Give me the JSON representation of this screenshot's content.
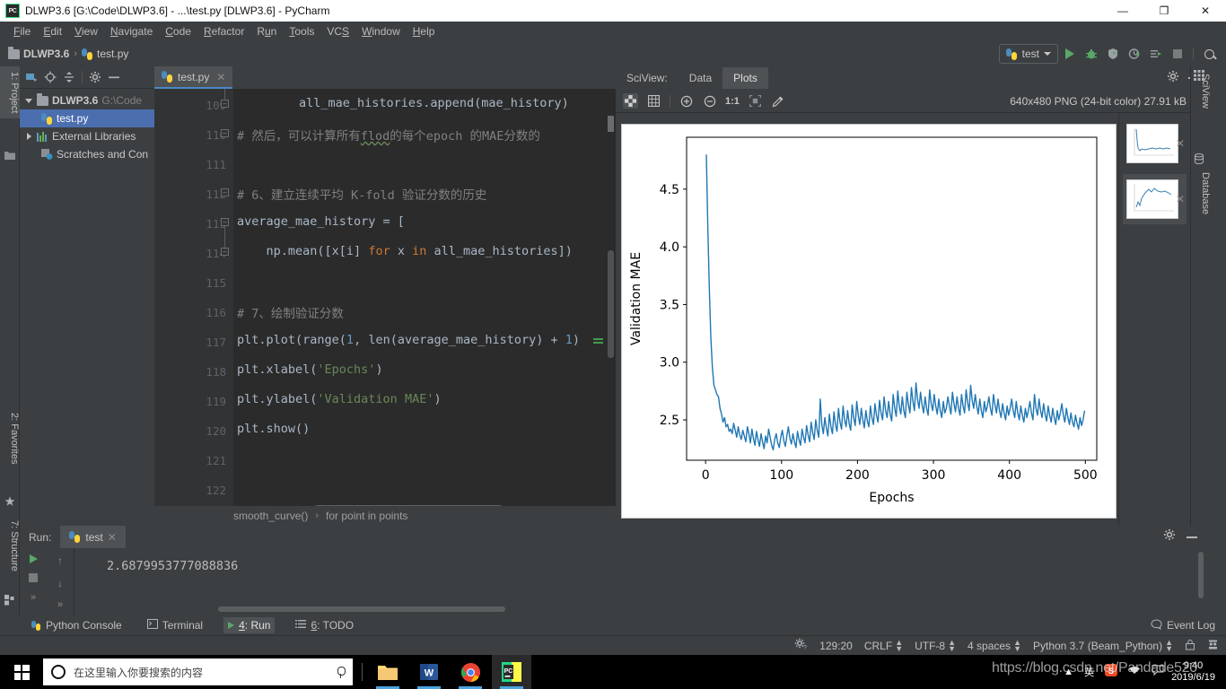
{
  "window": {
    "title": "DLWP3.6 [G:\\Code\\DLWP3.6] - ...\\test.py [DLWP3.6] - PyCharm",
    "app_icon": "pycharm-icon",
    "minimize": "—",
    "maximize": "❐",
    "close": "✕"
  },
  "menubar": {
    "items": [
      "File",
      "Edit",
      "View",
      "Navigate",
      "Code",
      "Refactor",
      "Run",
      "Tools",
      "VCS",
      "Window",
      "Help"
    ]
  },
  "navbar": {
    "crumbs": [
      {
        "label": "DLWP3.6",
        "icon": "folder-icon"
      },
      {
        "label": "test.py",
        "icon": "python-file-icon"
      }
    ],
    "separator": "›",
    "run_config": "test",
    "actions": [
      "run-button",
      "debug-button",
      "coverage-button",
      "profile-button",
      "run-with-console-button",
      "stop-button",
      "search-everywhere-button"
    ]
  },
  "left_strip": {
    "top_tab": "1: Project",
    "bottom_tabs": [
      "2: Favorites",
      "7: Structure"
    ]
  },
  "project": {
    "toolbar": [
      "select-opened-file-icon",
      "locate-icon",
      "collapse-all-icon",
      "settings-icon",
      "hide-icon"
    ],
    "tree": [
      {
        "label": "DLWP3.6",
        "suffix": "G:\\Code",
        "twist": "down",
        "icon": "folder-icon",
        "indent": 0,
        "selected": false,
        "bold": true
      },
      {
        "label": "test.py",
        "suffix": "",
        "twist": "none",
        "icon": "python-file-icon",
        "indent": 1,
        "selected": true,
        "bold": false
      },
      {
        "label": "External Libraries",
        "suffix": "",
        "twist": "right",
        "icon": "library-icon",
        "indent": 0,
        "selected": false,
        "bold": false
      },
      {
        "label": "Scratches and Con",
        "suffix": "",
        "twist": "none",
        "icon": "scratch-icon",
        "indent": 1,
        "selected": false,
        "bold": false
      }
    ]
  },
  "editor": {
    "tab": {
      "label": "test.py",
      "icon": "python-file-icon",
      "close": "✕"
    },
    "lines": [
      {
        "n": "109",
        "fold": "minus-small",
        "text": "        all_mae_histories.append(mae_history)",
        "kind": "code"
      },
      {
        "n": "110",
        "fold": "minus-cap",
        "text": "# 然后，可以计算所有flod的每个epoch 的MAE分数的",
        "kind": "comment"
      },
      {
        "n": "111",
        "fold": "",
        "text": "",
        "kind": "code"
      },
      {
        "n": "112",
        "fold": "minus-small",
        "text": "# 6、建立连续平均 K-fold 验证分数的历史",
        "kind": "comment"
      },
      {
        "n": "113",
        "fold": "minus-cap",
        "text": "average_mae_history = [",
        "kind": "code"
      },
      {
        "n": "114",
        "fold": "minus-small",
        "text": "    np.mean([x[i] for x in all_mae_histories])",
        "kind": "code"
      },
      {
        "n": "115",
        "fold": "",
        "text": "",
        "kind": "code"
      },
      {
        "n": "116",
        "fold": "",
        "text": "# 7、绘制验证分数",
        "kind": "comment"
      },
      {
        "n": "117",
        "fold": "",
        "text": "plt.plot(range(1, len(average_mae_history) + 1)",
        "kind": "code"
      },
      {
        "n": "118",
        "fold": "",
        "text": "plt.xlabel('Epochs')",
        "kind": "code"
      },
      {
        "n": "119",
        "fold": "",
        "text": "plt.ylabel('Validation MAE')",
        "kind": "code"
      },
      {
        "n": "120",
        "fold": "",
        "text": "plt.show()",
        "kind": "code"
      },
      {
        "n": "121",
        "fold": "",
        "text": "",
        "kind": "code"
      },
      {
        "n": "122",
        "fold": "",
        "text": "",
        "kind": "code"
      }
    ],
    "breadcrumb": [
      "smooth_curve()",
      "for point in points"
    ],
    "breadcrumb_sep": "›"
  },
  "sciview": {
    "label": "SciView:",
    "tabs": [
      {
        "label": "Data",
        "active": false
      },
      {
        "label": "Plots",
        "active": true
      }
    ],
    "toolbar": [
      "transparency-grid-icon",
      "grid-icon",
      "zoom-in-icon",
      "zoom-out-icon",
      "actual-size-icon",
      "fit-icon",
      "color-picker-icon"
    ],
    "zoom_label": "1:1",
    "image_meta": "640x480 PNG (24-bit color) 27.91 kB",
    "actions": [
      "settings-icon",
      "hide-icon"
    ],
    "thumbnails": [
      {
        "name": "plot-thumbnail-1",
        "selected": false,
        "close": "✕"
      },
      {
        "name": "plot-thumbnail-2",
        "selected": true,
        "close": "✕"
      }
    ],
    "right_tabs": [
      "SciView",
      "Database"
    ]
  },
  "chart_data": {
    "type": "line",
    "title": "",
    "xlabel": "Epochs",
    "ylabel": "Validation MAE",
    "xlim": [
      -25,
      515
    ],
    "ylim": [
      2.15,
      4.95
    ],
    "xticks": [
      0,
      100,
      200,
      300,
      400,
      500
    ],
    "yticks": [
      2.5,
      3.0,
      3.5,
      4.0,
      4.5
    ],
    "grid": false,
    "legend": false,
    "line_color": "#1f77b4",
    "series": [
      {
        "name": "Validation MAE",
        "x": [
          1,
          3,
          5,
          7,
          9,
          11,
          13,
          15,
          17,
          19,
          21,
          23,
          25,
          27,
          29,
          31,
          33,
          35,
          37,
          39,
          41,
          43,
          45,
          47,
          49,
          51,
          53,
          55,
          57,
          59,
          61,
          63,
          65,
          67,
          69,
          71,
          73,
          75,
          77,
          79,
          81,
          83,
          85,
          87,
          89,
          91,
          93,
          95,
          97,
          99,
          101,
          103,
          105,
          107,
          109,
          111,
          113,
          115,
          117,
          119,
          121,
          123,
          125,
          127,
          129,
          131,
          133,
          135,
          137,
          139,
          141,
          143,
          145,
          147,
          149,
          151,
          153,
          155,
          157,
          159,
          161,
          163,
          165,
          167,
          169,
          171,
          173,
          175,
          177,
          179,
          181,
          183,
          185,
          187,
          189,
          191,
          193,
          195,
          197,
          199,
          201,
          203,
          205,
          207,
          209,
          211,
          213,
          215,
          217,
          219,
          221,
          223,
          225,
          227,
          229,
          231,
          233,
          235,
          237,
          239,
          241,
          243,
          245,
          247,
          249,
          251,
          253,
          255,
          257,
          259,
          261,
          263,
          265,
          267,
          269,
          271,
          273,
          275,
          277,
          279,
          281,
          283,
          285,
          287,
          289,
          291,
          293,
          295,
          297,
          299,
          301,
          303,
          305,
          307,
          309,
          311,
          313,
          315,
          317,
          319,
          321,
          323,
          325,
          327,
          329,
          331,
          333,
          335,
          337,
          339,
          341,
          343,
          345,
          347,
          349,
          351,
          353,
          355,
          357,
          359,
          361,
          363,
          365,
          367,
          369,
          371,
          373,
          375,
          377,
          379,
          381,
          383,
          385,
          387,
          389,
          391,
          393,
          395,
          397,
          399,
          401,
          403,
          405,
          407,
          409,
          411,
          413,
          415,
          417,
          419,
          421,
          423,
          425,
          427,
          429,
          431,
          433,
          435,
          437,
          439,
          441,
          443,
          445,
          447,
          449,
          451,
          453,
          455,
          457,
          459,
          461,
          463,
          465,
          467,
          469,
          471,
          473,
          475,
          477,
          479,
          481,
          483,
          485,
          487,
          489,
          491,
          493,
          495,
          497,
          499
        ],
        "y": [
          4.8,
          4.15,
          3.62,
          3.2,
          2.95,
          2.8,
          2.76,
          2.72,
          2.7,
          2.6,
          2.55,
          2.48,
          2.52,
          2.44,
          2.46,
          2.4,
          2.42,
          2.38,
          2.47,
          2.41,
          2.35,
          2.44,
          2.37,
          2.33,
          2.41,
          2.36,
          2.31,
          2.44,
          2.38,
          2.3,
          2.42,
          2.34,
          2.28,
          2.4,
          2.33,
          2.27,
          2.38,
          2.31,
          2.25,
          2.36,
          2.3,
          2.42,
          2.35,
          2.28,
          2.24,
          2.33,
          2.38,
          2.3,
          2.26,
          2.35,
          2.41,
          2.32,
          2.27,
          2.36,
          2.44,
          2.34,
          2.29,
          2.38,
          2.31,
          2.26,
          2.4,
          2.33,
          2.28,
          2.42,
          2.35,
          2.3,
          2.45,
          2.37,
          2.31,
          2.48,
          2.39,
          2.33,
          2.5,
          2.41,
          2.35,
          2.68,
          2.46,
          2.38,
          2.52,
          2.43,
          2.36,
          2.55,
          2.44,
          2.38,
          2.57,
          2.46,
          2.4,
          2.6,
          2.48,
          2.42,
          2.62,
          2.5,
          2.44,
          2.58,
          2.47,
          2.41,
          2.63,
          2.52,
          2.45,
          2.66,
          2.54,
          2.46,
          2.6,
          2.5,
          2.43,
          2.58,
          2.49,
          2.44,
          2.62,
          2.52,
          2.46,
          2.64,
          2.54,
          2.48,
          2.67,
          2.56,
          2.5,
          2.7,
          2.58,
          2.52,
          2.66,
          2.55,
          2.49,
          2.72,
          2.6,
          2.53,
          2.75,
          2.62,
          2.55,
          2.7,
          2.58,
          2.52,
          2.74,
          2.63,
          2.56,
          2.78,
          2.66,
          2.58,
          2.82,
          2.68,
          2.6,
          2.74,
          2.63,
          2.56,
          2.7,
          2.6,
          2.54,
          2.76,
          2.64,
          2.58,
          2.72,
          2.62,
          2.55,
          2.68,
          2.58,
          2.52,
          2.66,
          2.56,
          2.6,
          2.7,
          2.62,
          2.55,
          2.74,
          2.64,
          2.57,
          2.7,
          2.6,
          2.54,
          2.72,
          2.62,
          2.56,
          2.76,
          2.65,
          2.58,
          2.8,
          2.67,
          2.6,
          2.72,
          2.62,
          2.55,
          2.68,
          2.58,
          2.52,
          2.66,
          2.57,
          2.62,
          2.7,
          2.6,
          2.54,
          2.72,
          2.63,
          2.56,
          2.68,
          2.58,
          2.52,
          2.64,
          2.56,
          2.5,
          2.62,
          2.54,
          2.6,
          2.68,
          2.58,
          2.52,
          2.66,
          2.56,
          2.5,
          2.62,
          2.54,
          2.48,
          2.6,
          2.52,
          2.58,
          2.66,
          2.56,
          2.5,
          2.72,
          2.6,
          2.54,
          2.68,
          2.58,
          2.52,
          2.64,
          2.55,
          2.49,
          2.62,
          2.54,
          2.48,
          2.6,
          2.52,
          2.46,
          2.58,
          2.5,
          2.56,
          2.64,
          2.54,
          2.48,
          2.6,
          2.52,
          2.46,
          2.56,
          2.48,
          2.44,
          2.54,
          2.47,
          2.42,
          2.52,
          2.45,
          2.5,
          2.58,
          2.49,
          2.44,
          2.54,
          2.47,
          2.42,
          2.52
        ]
      }
    ]
  },
  "run": {
    "label": "Run:",
    "tab": {
      "label": "test",
      "icon": "python-file-icon",
      "close": "✕"
    },
    "side_buttons": [
      "rerun-button",
      "stop-button",
      "expand-button",
      "up-button",
      "down-button",
      "soft-wrap-button"
    ],
    "output": "2.6879953777088836",
    "actions": [
      "settings-icon",
      "hide-icon"
    ]
  },
  "bottom_strip": {
    "items": [
      {
        "label": "Python Console",
        "icon": "python-console-icon",
        "selected": false
      },
      {
        "label": "Terminal",
        "icon": "terminal-icon",
        "selected": false
      },
      {
        "label": "4: Run",
        "icon": "run-icon",
        "selected": true
      },
      {
        "label": "6: TODO",
        "icon": "todo-icon",
        "selected": false
      }
    ],
    "event_log": {
      "label": "Event Log",
      "icon": "event-log-icon"
    }
  },
  "statusbar": {
    "items": [
      {
        "name": "background-tasks-icon",
        "label": ""
      },
      {
        "name": "caret-position",
        "label": "129:20"
      },
      {
        "name": "line-separator",
        "label": "CRLF"
      },
      {
        "name": "file-encoding",
        "label": "UTF-8"
      },
      {
        "name": "indent",
        "label": "4 spaces"
      },
      {
        "name": "python-interpreter",
        "label": "Python 3.7 (Beam_Python)"
      },
      {
        "name": "lock-icon",
        "label": ""
      },
      {
        "name": "inspector-icon",
        "label": ""
      }
    ]
  },
  "taskbar": {
    "start": "windows-logo",
    "search_placeholder": "在这里输入你要搜索的内容",
    "apps": [
      {
        "name": "file-explorer-icon",
        "active": false
      },
      {
        "name": "word-icon",
        "active": false
      },
      {
        "name": "chrome-icon",
        "active": false
      },
      {
        "name": "pycharm-icon",
        "active": true
      }
    ],
    "tray": [
      "show-hidden-icon",
      "input-method-icon",
      "sogou-icon",
      "network-icon",
      "speech-icon"
    ],
    "clock_time": "9:40",
    "clock_date": "2019/6/19"
  },
  "watermark": "https://blog.csdn.net/Pandade520"
}
